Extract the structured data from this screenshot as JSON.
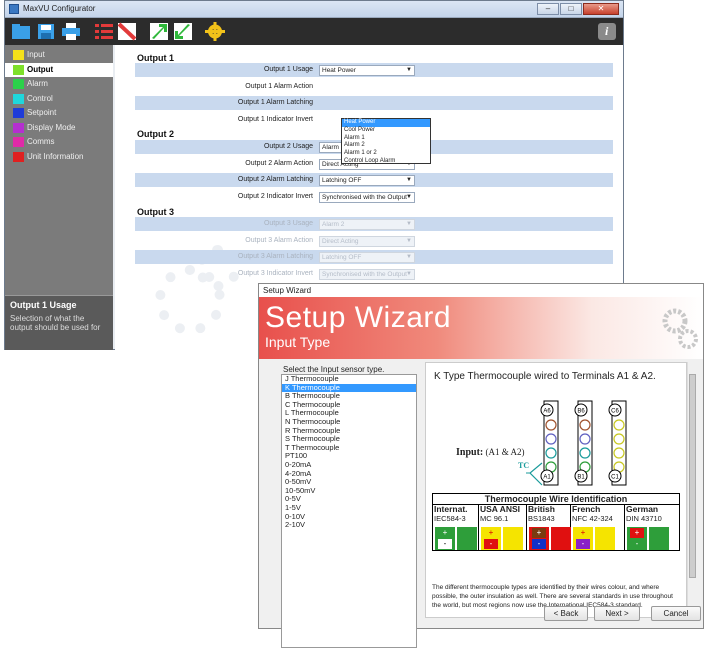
{
  "configurator": {
    "window_title": "MaxVU Configurator",
    "window_buttons": {
      "minimize": "–",
      "maximize": "□",
      "close": "✕"
    },
    "toolbar_icons": [
      "open-folder-icon",
      "save-icon",
      "print-icon",
      "list-icon",
      "clear-icon",
      "upload-icon",
      "download-icon",
      "settings-icon",
      "info-icon"
    ],
    "info_label": "i",
    "sidebar": {
      "items": [
        {
          "label": "Input",
          "color": "#f5e11a"
        },
        {
          "label": "Output",
          "color": "#7ee02a"
        },
        {
          "label": "Alarm",
          "color": "#2bd14a"
        },
        {
          "label": "Control",
          "color": "#1fd7dc"
        },
        {
          "label": "Setpoint",
          "color": "#1e3bd9"
        },
        {
          "label": "Display Mode",
          "color": "#b52fd0"
        },
        {
          "label": "Comms",
          "color": "#e02aa8"
        },
        {
          "label": "Unit Information",
          "color": "#e02020"
        }
      ],
      "selected": "Output",
      "help_title": "Output 1 Usage",
      "help_text": "Selection of what the output should be used for"
    },
    "output1": {
      "title": "Output 1",
      "rows": [
        {
          "label": "Output 1 Usage",
          "value": "Heat Power"
        },
        {
          "label": "Output 1 Alarm Action",
          "value": ""
        },
        {
          "label": "Output 1 Alarm Latching",
          "value": ""
        },
        {
          "label": "Output 1 Indicator Invert",
          "value": ""
        }
      ],
      "dropdown_options": [
        "Heat Power",
        "Cool Power",
        "Alarm 1",
        "Alarm 2",
        "Alarm 1 or 2",
        "Control Loop Alarm"
      ],
      "dropdown_highlighted": "Heat Power"
    },
    "output2": {
      "title": "Output 2",
      "rows": [
        {
          "label": "Output 2 Usage",
          "value": "Alarm 1"
        },
        {
          "label": "Output 2 Alarm Action",
          "value": "Direct Acting"
        },
        {
          "label": "Output 2 Alarm Latching",
          "value": "Latching OFF"
        },
        {
          "label": "Output 2 Indicator Invert",
          "value": "Synchronised with the Output"
        }
      ]
    },
    "output3": {
      "title": "Output 3",
      "rows": [
        {
          "label": "Output 3 Usage",
          "value": "Alarm 2"
        },
        {
          "label": "Output 3 Alarm Action",
          "value": "Direct Acting"
        },
        {
          "label": "Output 3 Alarm Latching",
          "value": "Latching OFF"
        },
        {
          "label": "Output 3 Indicator Invert",
          "value": "Synchronised with the Output"
        }
      ]
    }
  },
  "wizard": {
    "window_title": "Setup Wizard",
    "banner_title": "Setup Wizard",
    "banner_subtitle": "Input Type",
    "prompt": "Select the Input sensor type.",
    "sensor_types": [
      "J Thermocouple",
      "K Thermocouple",
      "B Thermocouple",
      "C Thermocouple",
      "L Thermocouple",
      "N Thermocouple",
      "R Thermocouple",
      "S Thermocouple",
      "T Thermocouple",
      "PT100",
      "0-20mA",
      "4-20mA",
      "0-50mV",
      "10-50mV",
      "0-5V",
      "1-5V",
      "0-10V",
      "2-10V"
    ],
    "selected_sensor": "K Thermocouple",
    "heading": "K Type Thermocouple wired to Terminals A1 & A2.",
    "input_label": "Input:",
    "input_terminals": "(A1 & A2)",
    "tc_label": "TC",
    "terminals": [
      "A6",
      "B6",
      "C6",
      "A1",
      "B1",
      "C1"
    ],
    "wire_table": {
      "title": "Thermocouple Wire Identification",
      "standards": [
        {
          "name": "Internat.",
          "code": "IEC584-3",
          "outer": "#2e9e3a",
          "plus": "#2e9e3a",
          "minus": "#ffffff"
        },
        {
          "name": "USA ANSI",
          "code": "MC 96.1",
          "outer": "#f5e400",
          "plus": "#f5e400",
          "minus": "#e01010"
        },
        {
          "name": "British",
          "code": "BS1843",
          "outer": "#e01010",
          "plus": "#7a3b10",
          "minus": "#1230c8"
        },
        {
          "name": "French",
          "code": "NFC 42-324",
          "outer": "#f5e400",
          "plus": "#f5e400",
          "minus": "#8a20c8"
        },
        {
          "name": "German",
          "code": "DIN 43710",
          "outer": "#2e9e3a",
          "plus": "#e01010",
          "minus": "#2e9e3a"
        }
      ],
      "plus_sign": "+",
      "minus_sign": "-"
    },
    "description": "The different thermocouple types are identified by their wires colour, and where possible, the outer insulation as well. There are several standards in use throughout the world, but most regions now use the International IEC584-3 standard.",
    "buttons": {
      "back": "< Back",
      "next": "Next >",
      "cancel": "Cancel"
    }
  }
}
